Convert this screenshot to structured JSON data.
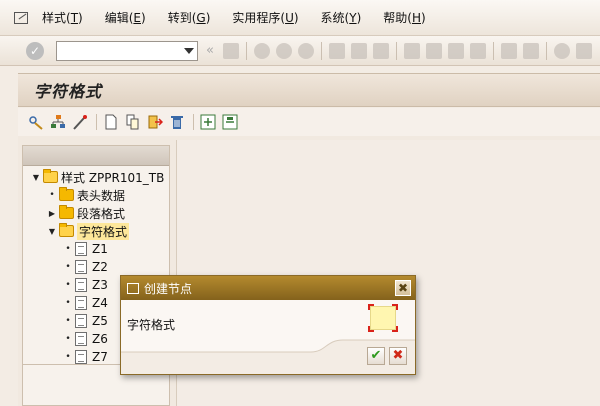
{
  "menu": [
    {
      "label": "样式(",
      "key": "T",
      "end": ")"
    },
    {
      "label": "编辑(",
      "key": "E",
      "end": ")"
    },
    {
      "label": "转到(",
      "key": "G",
      "end": ")"
    },
    {
      "label": "实用程序(",
      "key": "U",
      "end": ")"
    },
    {
      "label": "系统(",
      "key": "Y",
      "end": ")"
    },
    {
      "label": "帮助(",
      "key": "H",
      "end": ")"
    }
  ],
  "toolbar": {
    "command_field_value": "",
    "arrows": "«"
  },
  "page": {
    "title": "字符格式"
  },
  "tree": {
    "root": "样式 ZPPR101_TB",
    "folders": [
      "表头数据",
      "段落格式",
      "字符格式"
    ],
    "items": [
      "Z1",
      "Z2",
      "Z3",
      "Z4",
      "Z5",
      "Z6",
      "Z7"
    ]
  },
  "dialog": {
    "title": "创建节点",
    "field_label": "字符格式",
    "field_value": "",
    "ok_glyph": "✔",
    "cancel_glyph": "✖",
    "close_glyph": "✖"
  },
  "colors": {
    "dialog_title": "#9c7626",
    "selection": "#fde79a",
    "folder": "#f5b800",
    "required_field": "#fff6b0"
  }
}
